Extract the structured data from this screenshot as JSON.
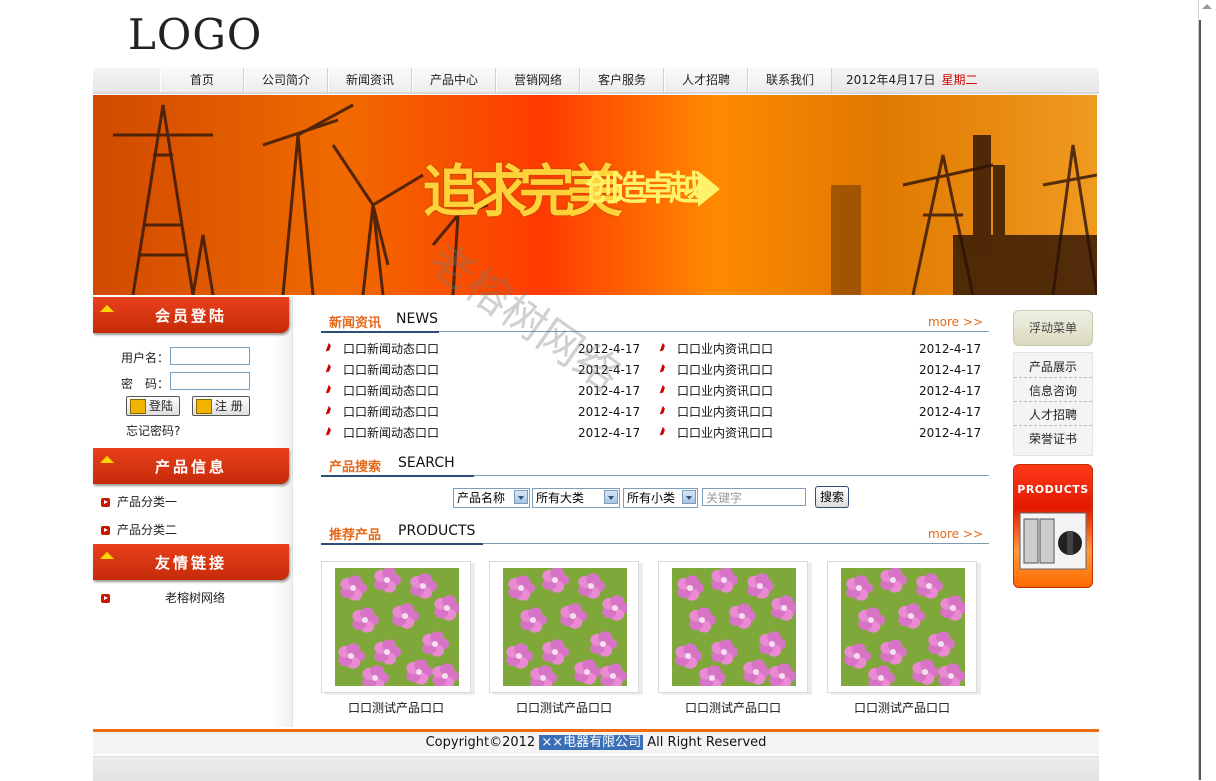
{
  "logo": "LOGO",
  "nav": {
    "items": [
      "首页",
      "公司简介",
      "新闻资讯",
      "产品中心",
      "营销网络",
      "客户服务",
      "人才招聘",
      "联系我们"
    ],
    "date": "2012年4月17日",
    "weekday": "星期二"
  },
  "banner": {
    "slogan1": "追求完美",
    "slogan2": "创造卓越"
  },
  "member": {
    "title": "会员登陆",
    "username_label": "用户名：",
    "password_label": "密　码：",
    "login_button": "登陆",
    "register_button": "注 册",
    "forgot": "忘记密码?"
  },
  "product_info": {
    "title": "产品信息",
    "items": [
      "产品分类一",
      "产品分类二"
    ]
  },
  "links": {
    "title": "友情链接",
    "items": [
      "老榕树网络"
    ]
  },
  "news": {
    "cn": "新闻资讯",
    "en": "NEWS",
    "more": "more >>",
    "left": [
      {
        "title": "口口新闻动态口口",
        "date": "2012-4-17"
      },
      {
        "title": "口口新闻动态口口",
        "date": "2012-4-17"
      },
      {
        "title": "口口新闻动态口口",
        "date": "2012-4-17"
      },
      {
        "title": "口口新闻动态口口",
        "date": "2012-4-17"
      },
      {
        "title": "口口新闻动态口口",
        "date": "2012-4-17"
      }
    ],
    "right": [
      {
        "title": "口口业内资讯口口",
        "date": "2012-4-17"
      },
      {
        "title": "口口业内资讯口口",
        "date": "2012-4-17"
      },
      {
        "title": "口口业内资讯口口",
        "date": "2012-4-17"
      },
      {
        "title": "口口业内资讯口口",
        "date": "2012-4-17"
      },
      {
        "title": "口口业内资讯口口",
        "date": "2012-4-17"
      }
    ]
  },
  "search": {
    "cn": "产品搜索",
    "en": "SEARCH",
    "select1": "产品名称",
    "select2": "所有大类",
    "select3": "所有小类",
    "keyword_placeholder": "关键字",
    "button": "搜索"
  },
  "products": {
    "cn": "推荐产品",
    "en": "PRODUCTS",
    "more": "more >>",
    "items": [
      "口口测试产品口口",
      "口口测试产品口口",
      "口口测试产品口口",
      "口口测试产品口口"
    ]
  },
  "float_menu": {
    "title": "浮动菜单",
    "items": [
      "产品展示",
      "信息咨询",
      "人才招聘",
      "荣誉证书"
    ],
    "ad_label": "PRODUCTS"
  },
  "footer": {
    "prefix": "Copyright©2012",
    "company": "××电器有限公司",
    "suffix": "All Right Reserved"
  },
  "watermark": "老榕树网络",
  "colors": {
    "accent": "#e46a1a",
    "section_red": "#d83616",
    "footer_line": "#ef6a10",
    "link_blue": "#2c4d7a"
  }
}
